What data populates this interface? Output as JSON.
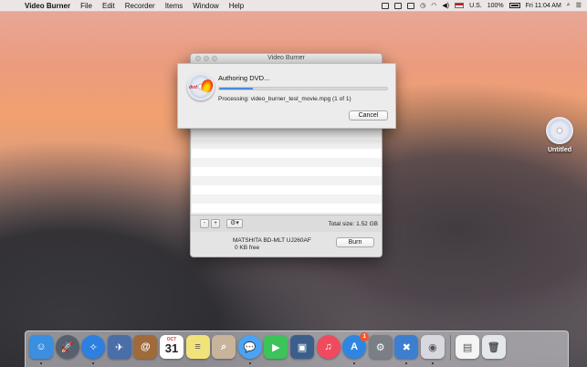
{
  "menubar": {
    "app_name": "Video Burner",
    "menus": [
      "File",
      "Edit",
      "Recorder",
      "Items",
      "Window",
      "Help"
    ],
    "status": {
      "input_source": "U.S.",
      "battery": "100%",
      "clock": "Fri 11:04 AM"
    }
  },
  "desktop": {
    "dvd_label": "Untitled"
  },
  "window": {
    "title": "Video Burner",
    "toolbar": {
      "remove_label": "-",
      "add_label": "+",
      "gear_label": "⚙▾",
      "total_size": "Total size: 1.52 GB"
    },
    "drive": {
      "name": "MATSHITA BD-MLT UJ260AF",
      "free": "0 KB free"
    },
    "burn_label": "Burn"
  },
  "sheet": {
    "heading": "Authoring DVD...",
    "progress": 0.2,
    "processing": "Processing: video_burner_test_movie.mpg (1 of 1)",
    "cancel_label": "Cancel",
    "dvd_tag": "dvd"
  },
  "dock": {
    "items": [
      {
        "name": "finder",
        "color": "#3b8fe0",
        "glyph": "☺"
      },
      {
        "name": "launchpad",
        "color": "#56606e",
        "glyph": "🚀"
      },
      {
        "name": "safari",
        "color": "#2d7fe0",
        "glyph": "✧"
      },
      {
        "name": "mail-photos",
        "color": "#4a6ea8",
        "glyph": "✈"
      },
      {
        "name": "contacts",
        "color": "#a06a3b",
        "glyph": "@"
      },
      {
        "name": "calendar",
        "color": "#ffffff",
        "glyph": ""
      },
      {
        "name": "notes",
        "color": "#f2e27a",
        "glyph": "≡"
      },
      {
        "name": "preview",
        "color": "#c8b49a",
        "glyph": "⌕"
      },
      {
        "name": "messages",
        "color": "#4aa3f5",
        "glyph": "💬"
      },
      {
        "name": "facetime",
        "color": "#3cc45a",
        "glyph": "▶"
      },
      {
        "name": "photo-booth",
        "color": "#3b5f8a",
        "glyph": "▣"
      },
      {
        "name": "itunes",
        "color": "#f04a5e",
        "glyph": "♫"
      },
      {
        "name": "app-store",
        "color": "#2e86e0",
        "glyph": "A",
        "badge": "1"
      },
      {
        "name": "system-preferences",
        "color": "#7a7f86",
        "glyph": "⚙"
      },
      {
        "name": "xcode",
        "color": "#3c7fd0",
        "glyph": "✖"
      },
      {
        "name": "video-burner",
        "color": "#d8d8e0",
        "glyph": "◉"
      }
    ],
    "calendar": {
      "month": "OCT",
      "day": "31"
    },
    "trash_items": [
      {
        "name": "downloads-stack",
        "color": "#f4f4f4",
        "glyph": "▤"
      },
      {
        "name": "trash",
        "color": "#e3e6ea",
        "glyph": "🗑"
      }
    ]
  }
}
